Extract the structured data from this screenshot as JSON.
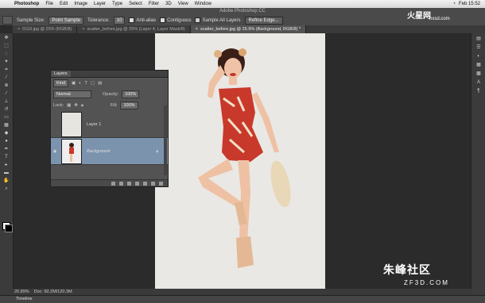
{
  "menubar": {
    "app": "Photoshop",
    "items": [
      "File",
      "Edit",
      "Image",
      "Layer",
      "Type",
      "Select",
      "Filter",
      "3D",
      "View",
      "Window"
    ],
    "clock": "Feb 15:52"
  },
  "window_title": "Adobe Photoshop CC",
  "options": {
    "sample_size_label": "Sample Size:",
    "sample_size_value": "Point Sample",
    "tolerance_label": "Tolerance:",
    "tolerance_value": "10",
    "anti_alias": "Anti-alias",
    "contiguous": "Contiguous",
    "sample_all_layers": "Sample All Layers",
    "refine_edge": "Refine Edge..."
  },
  "tabs": [
    {
      "label": "0119.jpg @ 25% (RGB/8)"
    },
    {
      "label": "scatter_before.jpg @ 25% (Layer 4, Layer Mask/8)"
    },
    {
      "label": "scatter_before.jpg @ 26.9% (Background, RGB/8) *"
    }
  ],
  "layers_panel": {
    "tab": "Layers",
    "kind": "Kind",
    "blend_mode": "Normal",
    "opacity_label": "Opacity:",
    "opacity_value": "100%",
    "lock_label": "Lock:",
    "fill_label": "Fill:",
    "fill_value": "100%",
    "layers": [
      {
        "name": "Layer 1",
        "selected": false
      },
      {
        "name": "Background",
        "selected": true
      }
    ]
  },
  "status": {
    "zoom": "26.89%",
    "doc": "Doc: 60.2M/120.3M"
  },
  "timeline": "Timeline",
  "watermark": {
    "logo": "火星网",
    "logo_sub": "hxsd.com",
    "bottom": "朱峰社区",
    "bottom_sub": "ZF3D.COM"
  },
  "colors": {
    "app_bg": "#2b2b2b",
    "panel": "#535353",
    "selected_layer": "#7c93ad",
    "canvas": "#e9e8e4",
    "dress": "#c8392b"
  }
}
